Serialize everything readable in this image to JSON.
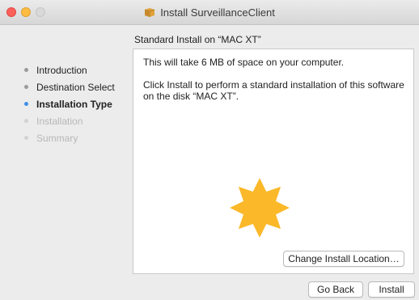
{
  "window": {
    "title": "Install SurveillanceClient",
    "heading": "Standard Install on “MAC XT”"
  },
  "sidebar": {
    "items": [
      {
        "label": "Introduction",
        "state": "done"
      },
      {
        "label": "Destination Select",
        "state": "done"
      },
      {
        "label": "Installation Type",
        "state": "active"
      },
      {
        "label": "Installation",
        "state": "disabled"
      },
      {
        "label": "Summary",
        "state": "disabled"
      }
    ]
  },
  "content": {
    "space_text": "This will take 6 MB of space on your computer.",
    "install_text": "Click Install to perform a standard installation of this software on the disk “MAC XT”.",
    "change_location_label": "Change Install Location…"
  },
  "footer": {
    "back_label": "Go Back",
    "install_label": "Install"
  },
  "icons": {
    "package": "package-icon",
    "badge": "yellow-star-badge"
  },
  "colors": {
    "accent": "#3f8ee8",
    "badge": "#fbb829",
    "close": "#fc605b",
    "minimize": "#fdbc40"
  }
}
